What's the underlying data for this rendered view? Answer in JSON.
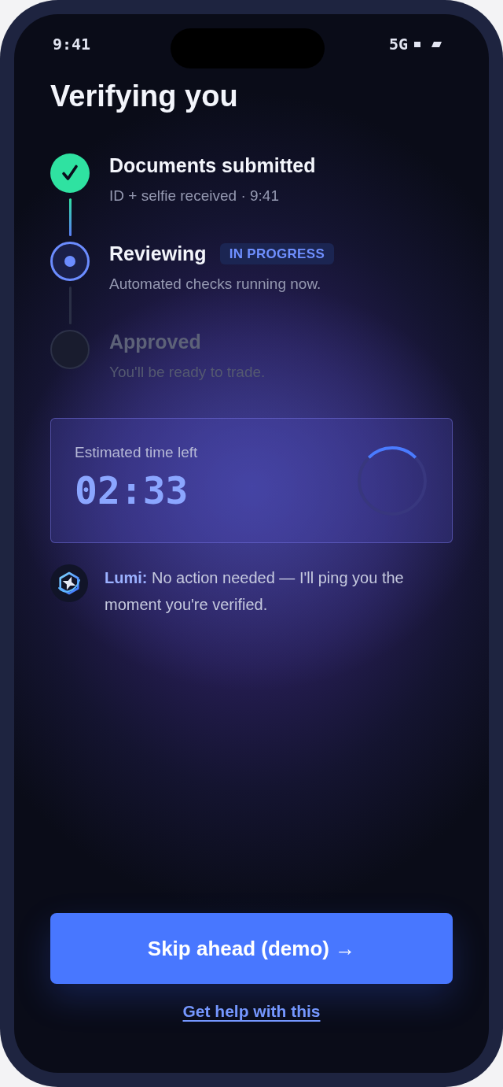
{
  "status_bar": {
    "time": "9:41",
    "network": "5G"
  },
  "title": "Verifying you",
  "steps": [
    {
      "kind": "done",
      "title": "Documents submitted",
      "subtitle": "ID + selfie received · 9:41"
    },
    {
      "kind": "current",
      "title": "Reviewing",
      "badge": "IN PROGRESS",
      "subtitle": "Automated checks running now."
    },
    {
      "kind": "pending",
      "title": "Approved",
      "subtitle": "You'll be ready to trade."
    }
  ],
  "estimate": {
    "label": "Estimated time left",
    "time": "02:33"
  },
  "assistant_message": "**Lumi:** No action needed — I'll ping you the moment you're verified.",
  "primary_button": "Skip ahead (demo) →",
  "help_link": "Get help with this"
}
